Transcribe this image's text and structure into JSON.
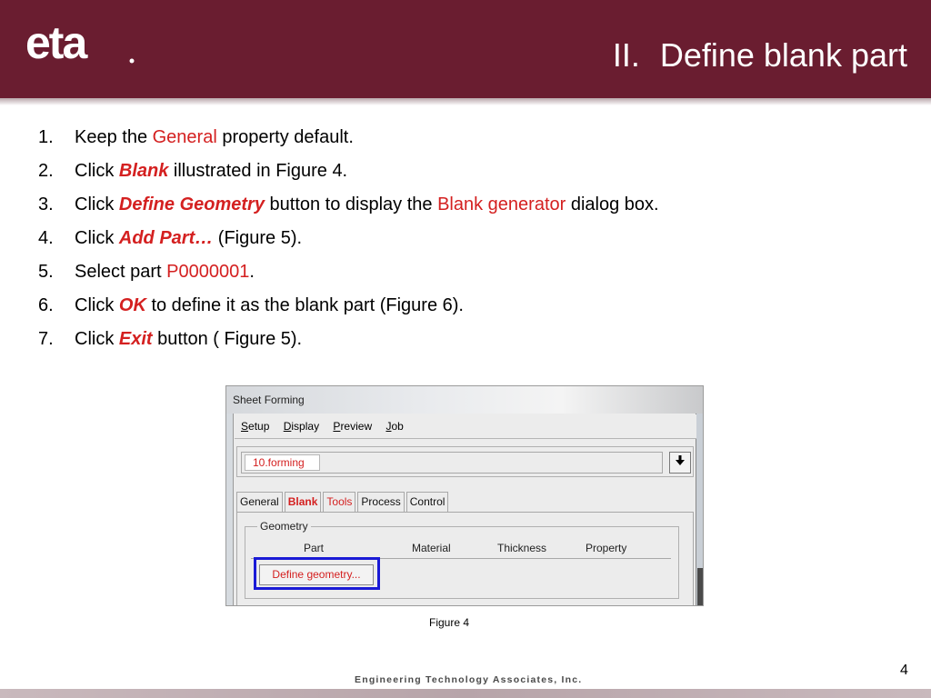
{
  "header": {
    "logo_text": "eta",
    "title_number": "II.",
    "title_text": "Define blank part"
  },
  "steps": [
    {
      "n": "1.",
      "parts": [
        [
          "Keep the ",
          "plain"
        ],
        [
          "General",
          "red"
        ],
        [
          " property default.",
          "plain"
        ]
      ]
    },
    {
      "n": "2.",
      "parts": [
        [
          "Click ",
          "plain"
        ],
        [
          "Blank",
          "em"
        ],
        [
          " illustrated in Figure 4.",
          "plain"
        ]
      ]
    },
    {
      "n": "3.",
      "parts": [
        [
          "Click ",
          "plain"
        ],
        [
          "Define Geometry",
          "em"
        ],
        [
          " button to display the ",
          "plain"
        ],
        [
          "Blank generator",
          "red"
        ],
        [
          " dialog box.",
          "plain"
        ]
      ]
    },
    {
      "n": "4.",
      "parts": [
        [
          "Click ",
          "plain"
        ],
        [
          "Add Part…",
          "em"
        ],
        [
          " (Figure 5).",
          "plain"
        ]
      ]
    },
    {
      "n": "5.",
      "parts": [
        [
          "Select part ",
          "plain"
        ],
        [
          "P0000001",
          "red"
        ],
        [
          ".",
          "plain"
        ]
      ]
    },
    {
      "n": "6.",
      "parts": [
        [
          "Click ",
          "plain"
        ],
        [
          "OK",
          "em"
        ],
        [
          " to define it as the blank part (Figure 6).",
          "plain"
        ]
      ]
    },
    {
      "n": "7.",
      "parts": [
        [
          "Click ",
          "plain"
        ],
        [
          "Exit",
          "em"
        ],
        [
          " button ( Figure 5).",
          "plain"
        ]
      ]
    }
  ],
  "figure": {
    "window_title": "Sheet Forming",
    "menu": [
      "Setup",
      "Display",
      "Preview",
      "Job"
    ],
    "combo_value": "10.forming",
    "combo_button_icon": "arrow-down-icon",
    "tabs": [
      {
        "label": "General",
        "state": "normal"
      },
      {
        "label": "Blank",
        "state": "active"
      },
      {
        "label": "Tools",
        "state": "red"
      },
      {
        "label": "Process",
        "state": "normal"
      },
      {
        "label": "Control",
        "state": "normal"
      }
    ],
    "group_title": "Geometry",
    "columns": [
      "Part",
      "Material",
      "Thickness",
      "Property"
    ],
    "define_button": "Define geometry...",
    "caption": "Figure 4"
  },
  "footer": {
    "company": "Engineering Technology Associates, Inc.",
    "page_number": "4"
  },
  "colors": {
    "header": "#6a1d30",
    "highlight_red": "#d42020",
    "selection_box": "#1a1ad6"
  }
}
